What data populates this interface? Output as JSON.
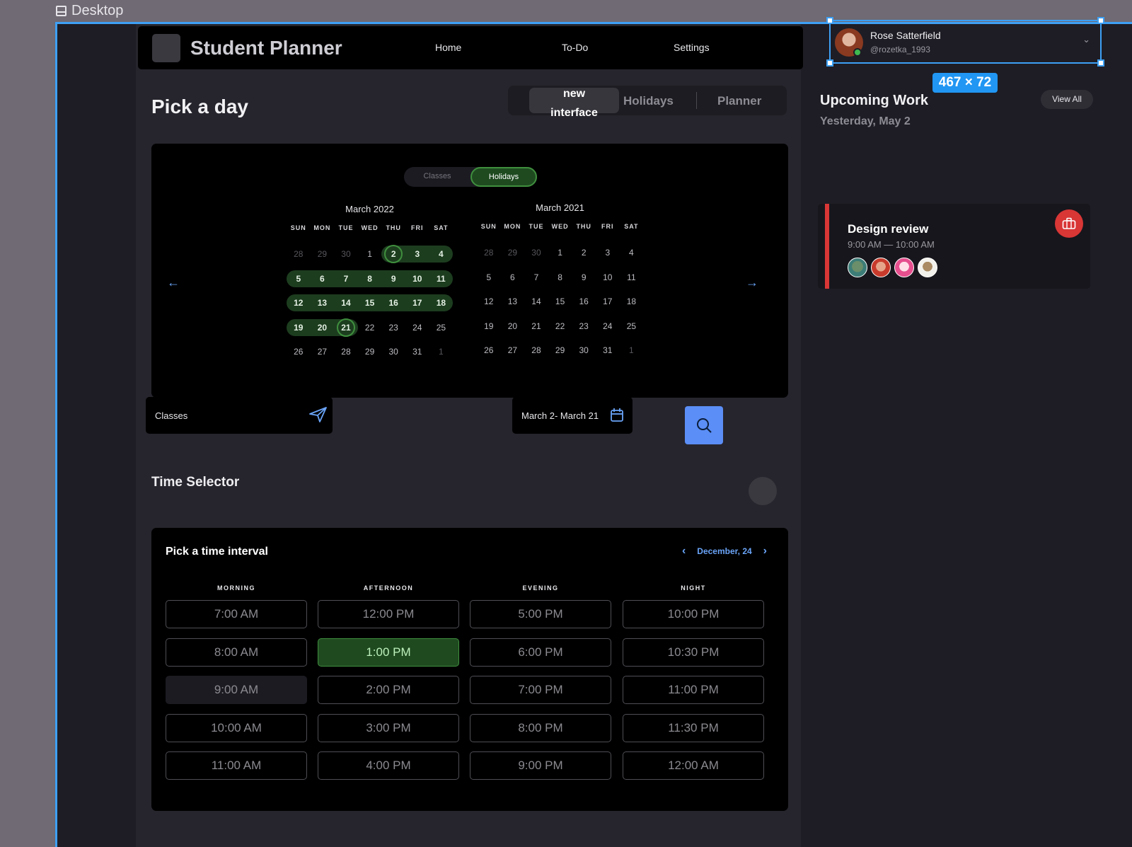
{
  "frame": {
    "label": "Desktop"
  },
  "header": {
    "title": "Student Planner",
    "nav": [
      "Home",
      "To-Do",
      "Settings"
    ]
  },
  "page": {
    "title": "Pick a day"
  },
  "segmented": {
    "active": "new interface",
    "options": [
      "Holidays",
      "Planner"
    ]
  },
  "calendar": {
    "toggle": [
      "Classes",
      "Holidays"
    ],
    "dow": [
      "SUN",
      "MON",
      "TUE",
      "WED",
      "THU",
      "FRI",
      "SAT"
    ],
    "left": {
      "title": "March 2022",
      "weeks": [
        [
          "28",
          "29",
          "30",
          "1",
          "2",
          "3",
          "4"
        ],
        [
          "5",
          "6",
          "7",
          "8",
          "9",
          "10",
          "11"
        ],
        [
          "12",
          "13",
          "14",
          "15",
          "16",
          "17",
          "18"
        ],
        [
          "19",
          "20",
          "21",
          "22",
          "23",
          "24",
          "25"
        ],
        [
          "26",
          "27",
          "28",
          "29",
          "30",
          "31",
          "1"
        ]
      ],
      "range_start": "2",
      "range_end": "21"
    },
    "right": {
      "title": "March 2021",
      "weeks": [
        [
          "28",
          "29",
          "30",
          "1",
          "2",
          "3",
          "4"
        ],
        [
          "5",
          "6",
          "7",
          "8",
          "9",
          "10",
          "11"
        ],
        [
          "12",
          "13",
          "14",
          "15",
          "16",
          "17",
          "18"
        ],
        [
          "19",
          "20",
          "21",
          "22",
          "23",
          "24",
          "25"
        ],
        [
          "26",
          "27",
          "28",
          "29",
          "30",
          "31",
          "1"
        ]
      ]
    },
    "prev_icon": "arrow-left-icon",
    "next_icon": "arrow-right-icon"
  },
  "filters": {
    "category_value": "Classes",
    "date_range_value": "March 2- March 21",
    "send_icon": "send-icon",
    "calendar_icon": "calendar-icon",
    "search_icon": "search-icon"
  },
  "time_selector": {
    "section_title": "Time Selector",
    "card_title": "Pick a time interval",
    "date": "December, 24",
    "columns": [
      {
        "header": "MORNING",
        "slots": [
          "7:00 AM",
          "8:00 AM",
          "9:00 AM",
          "10:00 AM",
          "11:00 AM"
        ]
      },
      {
        "header": "AFTERNOON",
        "slots": [
          "12:00 PM",
          "1:00 PM",
          "2:00 PM",
          "3:00 PM",
          "4:00 PM"
        ]
      },
      {
        "header": "EVENING",
        "slots": [
          "5:00 PM",
          "6:00 PM",
          "7:00 PM",
          "8:00 PM",
          "9:00 PM"
        ]
      },
      {
        "header": "NIGHT",
        "slots": [
          "10:00 PM",
          "10:30 PM",
          "11:00 PM",
          "11:30 PM",
          "12:00 AM"
        ]
      }
    ],
    "selected": "1:00 PM",
    "disabled": "9:00 AM"
  },
  "user": {
    "name": "Rose Satterfield",
    "handle": "@rozetka_1993",
    "selection_size": "467 × 72"
  },
  "upcoming": {
    "title": "Upcoming Work",
    "date": "Yesterday, May 2",
    "view_all": "View All",
    "event": {
      "title": "Design review",
      "time": "9:00 AM — 10:00 AM",
      "icon": "briefcase-icon",
      "attendees": 4
    }
  },
  "colors": {
    "accent_green": "#3f8f3e",
    "accent_blue": "#5b8ef6",
    "event_red": "#d93636",
    "selection_blue": "#3ea0f5"
  }
}
